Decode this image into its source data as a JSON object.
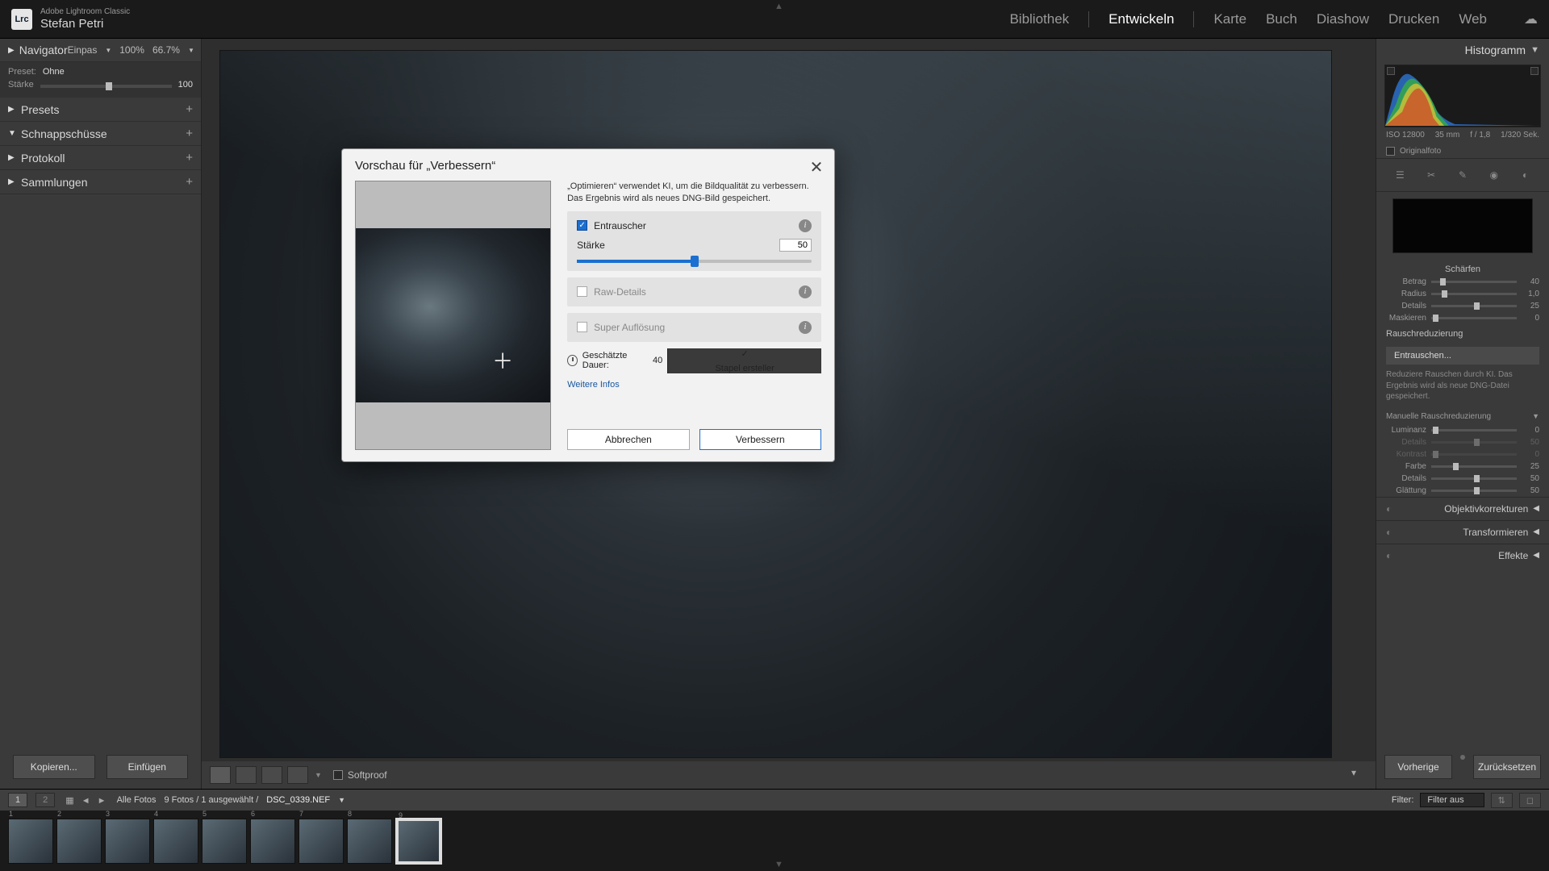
{
  "app": {
    "product": "Adobe Lightroom Classic",
    "logo": "Lrc",
    "user": "Stefan Petri"
  },
  "modules": {
    "items": [
      "Bibliothek",
      "Entwickeln",
      "Karte",
      "Buch",
      "Diashow",
      "Drucken",
      "Web"
    ],
    "active": "Entwickeln"
  },
  "left": {
    "navigator": {
      "title": "Navigator",
      "fit": "Einpas",
      "zoom1": "100%",
      "zoom2": "66.7%",
      "preset_label": "Preset:",
      "preset_value": "Ohne",
      "amount_label": "Stärke",
      "amount_value": "100"
    },
    "panels": [
      "Presets",
      "Schnappschüsse",
      "Protokoll",
      "Sammlungen"
    ],
    "expanded": "Schnappschüsse",
    "buttons": {
      "copy": "Kopieren...",
      "paste": "Einfügen"
    }
  },
  "center": {
    "softproof": "Softproof"
  },
  "right": {
    "histogram": {
      "title": "Histogramm",
      "iso": "ISO 12800",
      "focal": "35 mm",
      "aperture": "f / 1,8",
      "shutter": "1/320 Sek.",
      "original": "Originalfoto"
    },
    "sharpen": {
      "title": "Schärfen",
      "rows": [
        {
          "label": "Betrag",
          "val": "40",
          "pos": 10
        },
        {
          "label": "Radius",
          "val": "1,0",
          "pos": 12
        },
        {
          "label": "Details",
          "val": "25",
          "pos": 50
        },
        {
          "label": "Maskieren",
          "val": "0",
          "pos": 2
        }
      ]
    },
    "noise": {
      "title": "Rauschreduzierung",
      "button": "Entrauschen...",
      "desc": "Reduziere Rauschen durch KI. Das Ergebnis wird als neue DNG-Datei gespeichert.",
      "manual_title": "Manuelle Rauschreduzierung",
      "rows": [
        {
          "label": "Luminanz",
          "val": "0",
          "pos": 2,
          "dis": false
        },
        {
          "label": "Details",
          "val": "50",
          "pos": 50,
          "dis": true
        },
        {
          "label": "Kontrast",
          "val": "0",
          "pos": 2,
          "dis": true
        },
        {
          "label": "Farbe",
          "val": "25",
          "pos": 25,
          "dis": false
        },
        {
          "label": "Details",
          "val": "50",
          "pos": 50,
          "dis": false
        },
        {
          "label": "Glättung",
          "val": "50",
          "pos": 50,
          "dis": false
        }
      ]
    },
    "collapsed": [
      "Objektivkorrekturen",
      "Transformieren",
      "Effekte"
    ],
    "footer": {
      "prev": "Vorherige",
      "reset": "Zurücksetzen"
    }
  },
  "dialog": {
    "title": "Vorschau für „Verbessern“",
    "desc": "„Optimieren“ verwendet KI, um die Bildqualität zu verbessern. Das Ergebnis wird als neues DNG-Bild gespeichert.",
    "denoise": {
      "label": "Entrauscher",
      "strength_label": "Stärke",
      "strength_value": "50"
    },
    "raw_details": "Raw-Details",
    "super_res": "Super Auflösung",
    "estimate_label": "Geschätzte Dauer:",
    "estimate_value": "40",
    "stack_label": "Stapel ersteller",
    "more_info": "Weitere Infos",
    "cancel": "Abbrechen",
    "enhance": "Verbessern"
  },
  "bottom": {
    "tab1": "1",
    "tab2": "2",
    "path": "Alle Fotos",
    "count": "9 Fotos / 1 ausgewählt /",
    "filename": "DSC_0339.NEF",
    "filter_label": "Filter:",
    "filter_value": "Filter aus",
    "thumbs": 9,
    "selected_index": 8
  }
}
